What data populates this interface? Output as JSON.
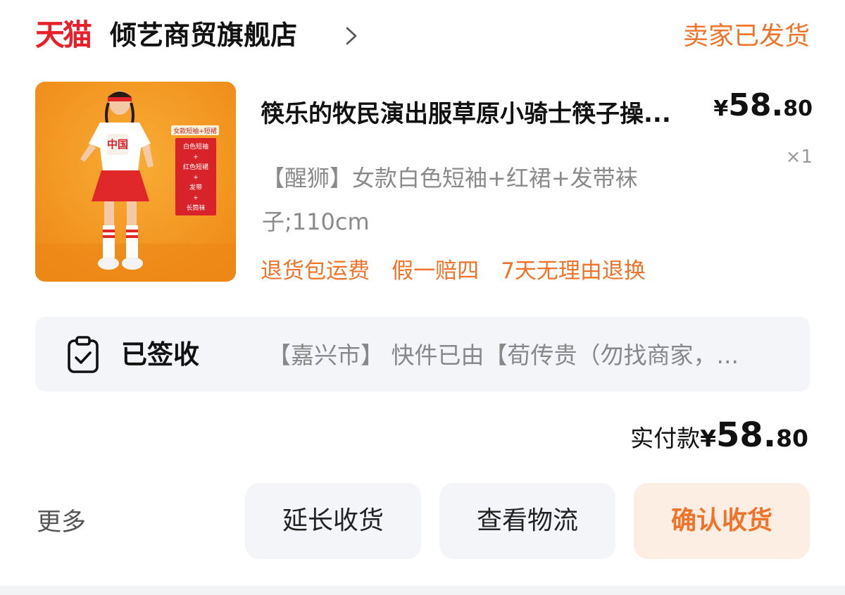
{
  "header": {
    "platform_logo_text": "天猫",
    "store_name": "倾艺商贸旗舰店",
    "order_status": "卖家已发货"
  },
  "product": {
    "image_caption": "女款短袖+短裙",
    "image_labels": [
      "白色短袖",
      "+",
      "红色短裙",
      "+",
      "发带",
      "+",
      "长筒袜"
    ],
    "image_shirt_print": "中国",
    "title": "筷乐的牧民演出服草原小骑士筷子操...",
    "price_currency": "¥",
    "price_integer": "58.",
    "price_decimal": "80",
    "quantity": "×1",
    "sku_line1": "【醒狮】女款白色短袖+红裙+发带袜",
    "sku_line2": "子;110cm",
    "service_tags": [
      "退货包运费",
      "假一赔四",
      "7天无理由退换"
    ]
  },
  "logistics": {
    "status": "已签收",
    "detail": "【嘉兴市】 快件已由【荀传贵（勿找商家，..."
  },
  "total": {
    "label": "实付款",
    "currency": "¥",
    "integer": "58.",
    "decimal": "80"
  },
  "actions": {
    "more": "更多",
    "extend_receipt": "延长收货",
    "view_logistics": "查看物流",
    "confirm_receipt": "确认收货"
  },
  "colors": {
    "brand_red": "#e8202a",
    "accent_orange": "#f0732a",
    "confirm_bg": "#fdeee4",
    "panel_gray": "#f3f5f8",
    "image_bg": "#f59a22"
  },
  "icons": [
    "chevron-right-icon",
    "clipboard-check-icon"
  ]
}
